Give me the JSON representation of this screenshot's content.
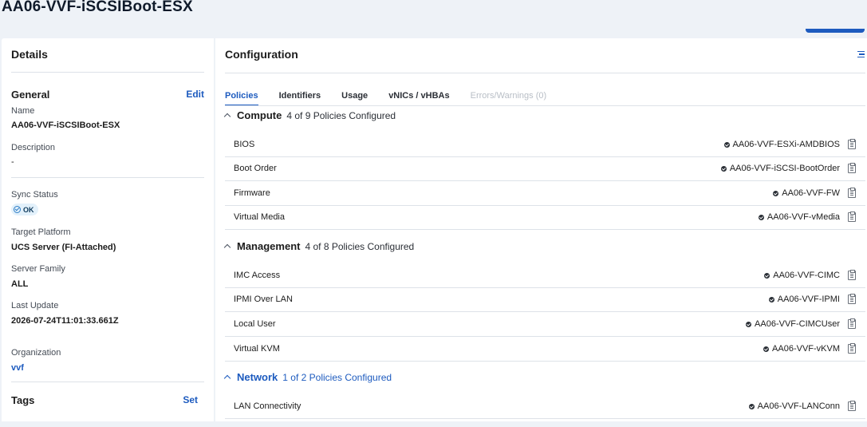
{
  "page": {
    "title": "AA06-VVF-iSCSIBoot-ESX"
  },
  "details": {
    "header": "Details",
    "general": {
      "title": "General",
      "edit_label": "Edit"
    },
    "name": {
      "label": "Name",
      "value": "AA06-VVF-iSCSIBoot-ESX"
    },
    "description": {
      "label": "Description",
      "value": "-"
    },
    "sync_status": {
      "label": "Sync Status",
      "value": "OK"
    },
    "target_platform": {
      "label": "Target Platform",
      "value": "UCS Server (FI-Attached)"
    },
    "server_family": {
      "label": "Server Family",
      "value": "ALL"
    },
    "last_update": {
      "label": "Last Update",
      "value": "2026-07-24T11:01:33.661Z"
    },
    "organization": {
      "label": "Organization",
      "value": "vvf"
    },
    "tags": {
      "title": "Tags",
      "set_label": "Set"
    }
  },
  "config": {
    "header": "Configuration",
    "tabs": [
      {
        "label": "Policies"
      },
      {
        "label": "Identifiers"
      },
      {
        "label": "Usage"
      },
      {
        "label": "vNICs / vHBAs"
      },
      {
        "label": "Errors/Warnings (0)"
      }
    ],
    "groups": [
      {
        "title": "Compute",
        "summary": "4 of 9 Policies Configured",
        "rows": [
          {
            "name": "BIOS",
            "policy": "AA06-VVF-ESXi-AMDBIOS"
          },
          {
            "name": "Boot Order",
            "policy": "AA06-VVF-iSCSI-BootOrder"
          },
          {
            "name": "Firmware",
            "policy": "AA06-VVF-FW"
          },
          {
            "name": "Virtual Media",
            "policy": "AA06-VVF-vMedia"
          }
        ]
      },
      {
        "title": "Management",
        "summary": "4 of 8 Policies Configured",
        "rows": [
          {
            "name": "IMC Access",
            "policy": "AA06-VVF-CIMC"
          },
          {
            "name": "IPMI Over LAN",
            "policy": "AA06-VVF-IPMI"
          },
          {
            "name": "Local User",
            "policy": "AA06-VVF-CIMCUser"
          },
          {
            "name": "Virtual KVM",
            "policy": "AA06-VVF-vKVM"
          }
        ]
      },
      {
        "title": "Network",
        "summary": "1 of 2 Policies Configured",
        "rows": [
          {
            "name": "LAN Connectivity",
            "policy": "AA06-VVF-LANConn"
          }
        ]
      }
    ]
  },
  "colors": {
    "accent": "#1d5bbf",
    "background": "#eef2f7",
    "ok_badge": "#e3f1fb"
  }
}
